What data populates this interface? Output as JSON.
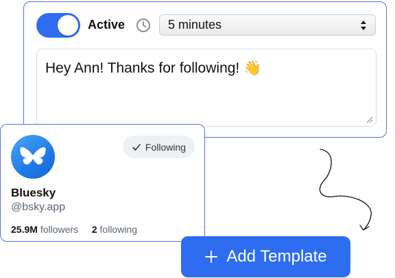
{
  "template": {
    "toggle": {
      "state": "on"
    },
    "active_label": "Active",
    "delay": {
      "icon": "clock-icon",
      "selected": "5 minutes"
    },
    "message": "Hey Ann! Thanks for following! 👋"
  },
  "profile": {
    "avatar_icon": "butterfly-icon",
    "following_label": "Following",
    "name": "Bluesky",
    "handle": "@bsky.app",
    "followers_count": "25.9M",
    "followers_label": "followers",
    "following_count": "2",
    "following_count_label": "following"
  },
  "actions": {
    "add_template_label": "Add Template"
  },
  "colors": {
    "accent": "#2f6df0",
    "card_border": "#5b6fdc"
  }
}
